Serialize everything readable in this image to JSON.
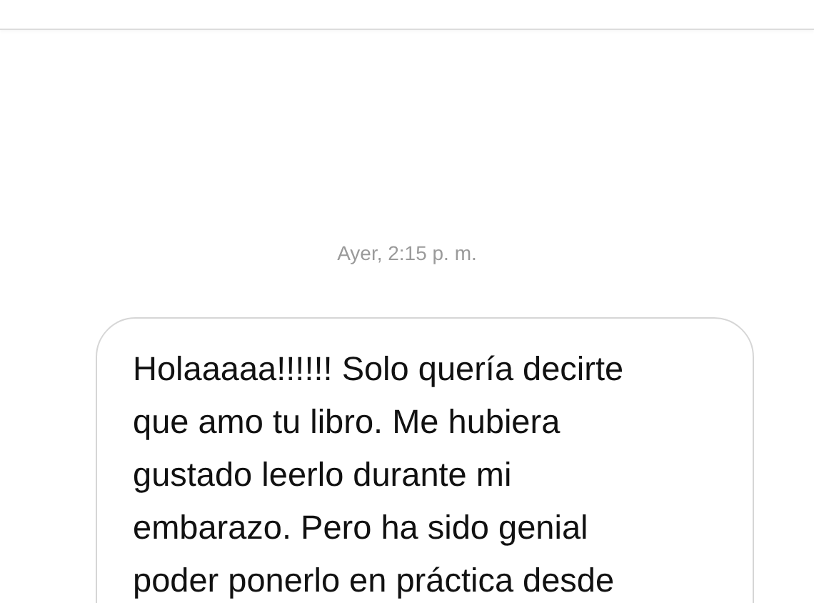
{
  "timestamp": "Ayer, 2:15 p. m.",
  "message": {
    "lines": [
      "Holaaaaa!!!!!! Solo quería decirte",
      "que amo tu libro. Me hubiera",
      "gustado leerlo durante mi",
      "embarazo. Pero ha sido genial",
      "poder ponerlo en práctica desde"
    ]
  }
}
